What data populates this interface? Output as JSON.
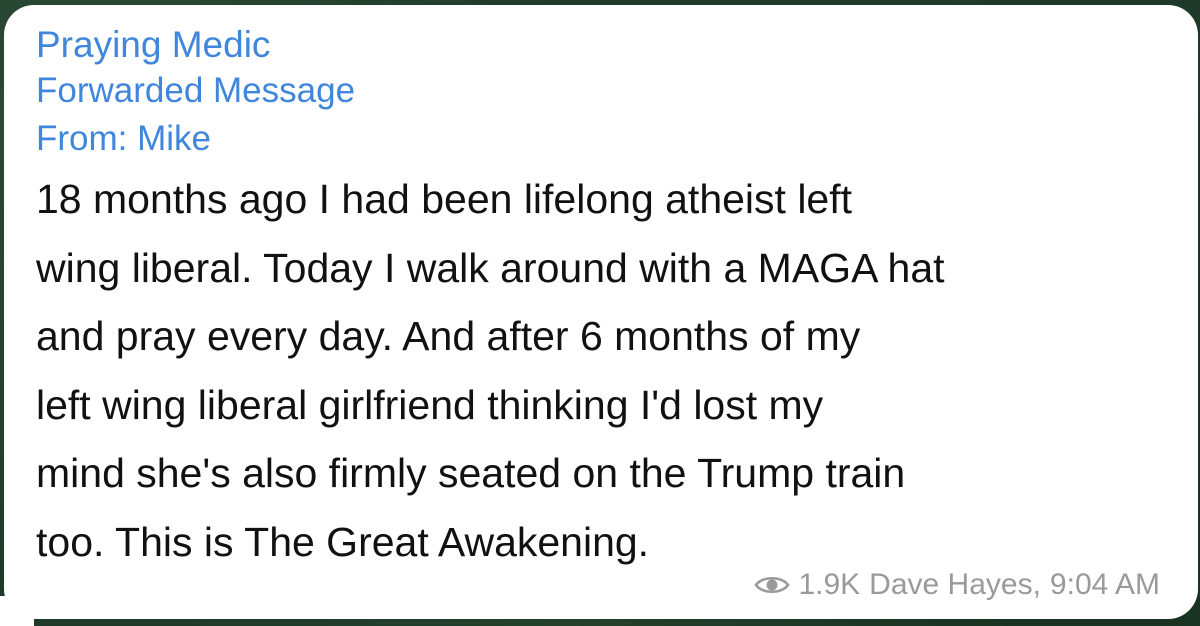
{
  "message": {
    "channel_name": "Praying Medic",
    "forwarded_label": "Forwarded Message",
    "from_label": "From: Mike",
    "text": "18 months ago I had been lifelong atheist left\nwing liberal. Today I walk around with a MAGA hat\nand pray every day.  And after 6 months of my\nleft wing liberal girlfriend thinking I'd lost my\nmind she's also firmly seated on the Trump train\ntoo. This is The Great Awakening.",
    "views": "1.9K",
    "author": "Dave Hayes,",
    "time": "9:04 AM",
    "views_icon": "eye-icon"
  },
  "colors": {
    "link_blue": "#3f86dc",
    "meta_gray": "#9a9a9a",
    "bubble_bg": "#ffffff",
    "text": "#111111"
  }
}
